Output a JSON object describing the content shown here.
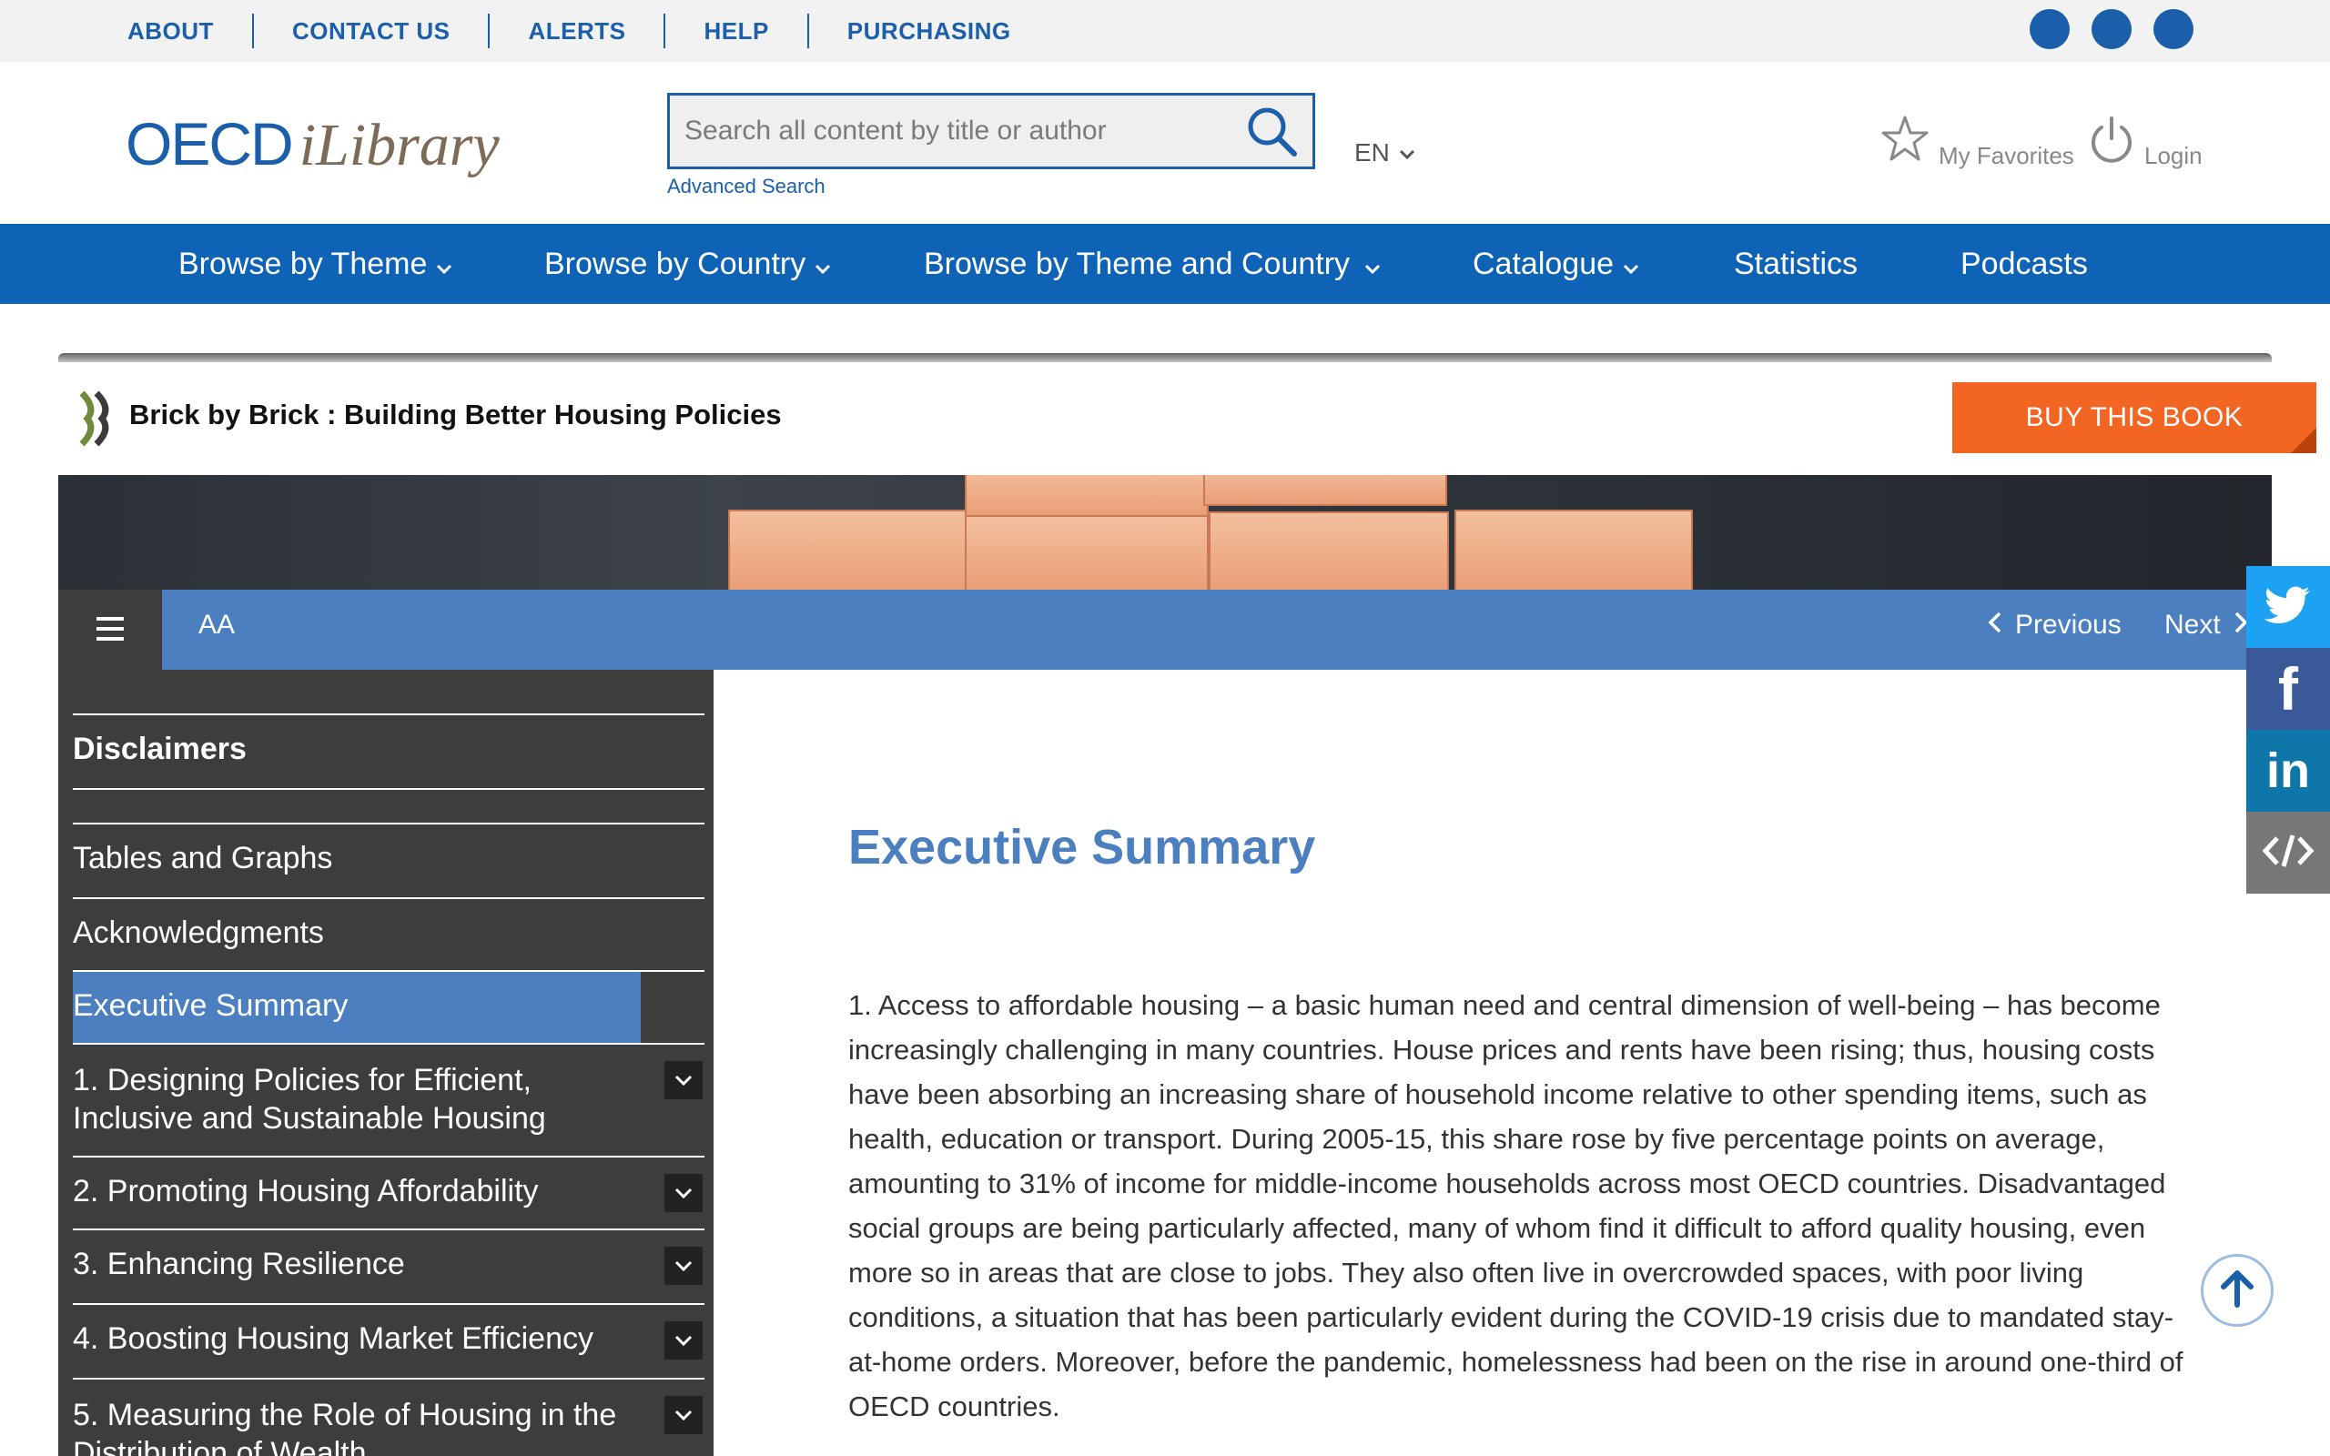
{
  "utility_nav": {
    "links": [
      "ABOUT",
      "CONTACT US",
      "ALERTS",
      "HELP",
      "PURCHASING"
    ]
  },
  "header": {
    "logo_oecd": "OECD",
    "logo_ilibrary": "iLibrary",
    "search_placeholder": "Search all content by title or author",
    "advanced_search": "Advanced Search",
    "language": "EN",
    "favorites": "My Favorites",
    "login": "Login"
  },
  "main_nav": {
    "items": [
      "Browse by Theme",
      "Browse by Country",
      "Browse by Theme and Country",
      "Catalogue",
      "Statistics",
      "Podcasts"
    ]
  },
  "book": {
    "title": "Brick by Brick : Building Better Housing Policies",
    "buy_label": "BUY THIS BOOK"
  },
  "reader": {
    "font_size_label": "AA",
    "previous": "Previous",
    "next": "Next"
  },
  "toc": {
    "items": [
      "Disclaimers",
      "Tables and Graphs",
      "Acknowledgments",
      "Executive Summary",
      "1. Designing Policies for Efficient, Inclusive and Sustainable Housing",
      "2. Promoting Housing Affordability",
      "3. Enhancing Resilience",
      "4. Boosting Housing Market Efficiency",
      "5. Measuring the Role of Housing in the Distribution of Wealth"
    ],
    "active_index": 3
  },
  "content": {
    "title": "Executive Summary",
    "paragraph": "1. Access to affordable housing – a basic human need and central dimension of well-being – has become increasingly challenging in many countries. House prices and rents have been rising; thus, housing costs have been absorbing an increasing share of household income relative to other spending items, such as health, education or transport. During 2005-15, this share rose by five percentage points on average, amounting to 31% of income for middle-income households across most OECD countries. Disadvantaged social groups are being particularly affected, many of whom find it difficult to afford quality housing, even more so in areas that are close to jobs. They also often live in overcrowded spaces, with poor living conditions, a situation that has been particularly evident during the COVID-19 crisis due to mandated stay-at-home orders. Moreover, before the pandemic, homelessness had been on the rise in around one-third of OECD countries."
  },
  "share_rail": [
    "twitter-icon",
    "facebook-icon",
    "linkedin-icon",
    "embed-code-icon"
  ],
  "colors": {
    "brand_blue": "#0f63b6",
    "reader_blue": "#4b7fc0",
    "buy_orange": "#f26522",
    "toc_bg": "#3d3d3d"
  }
}
